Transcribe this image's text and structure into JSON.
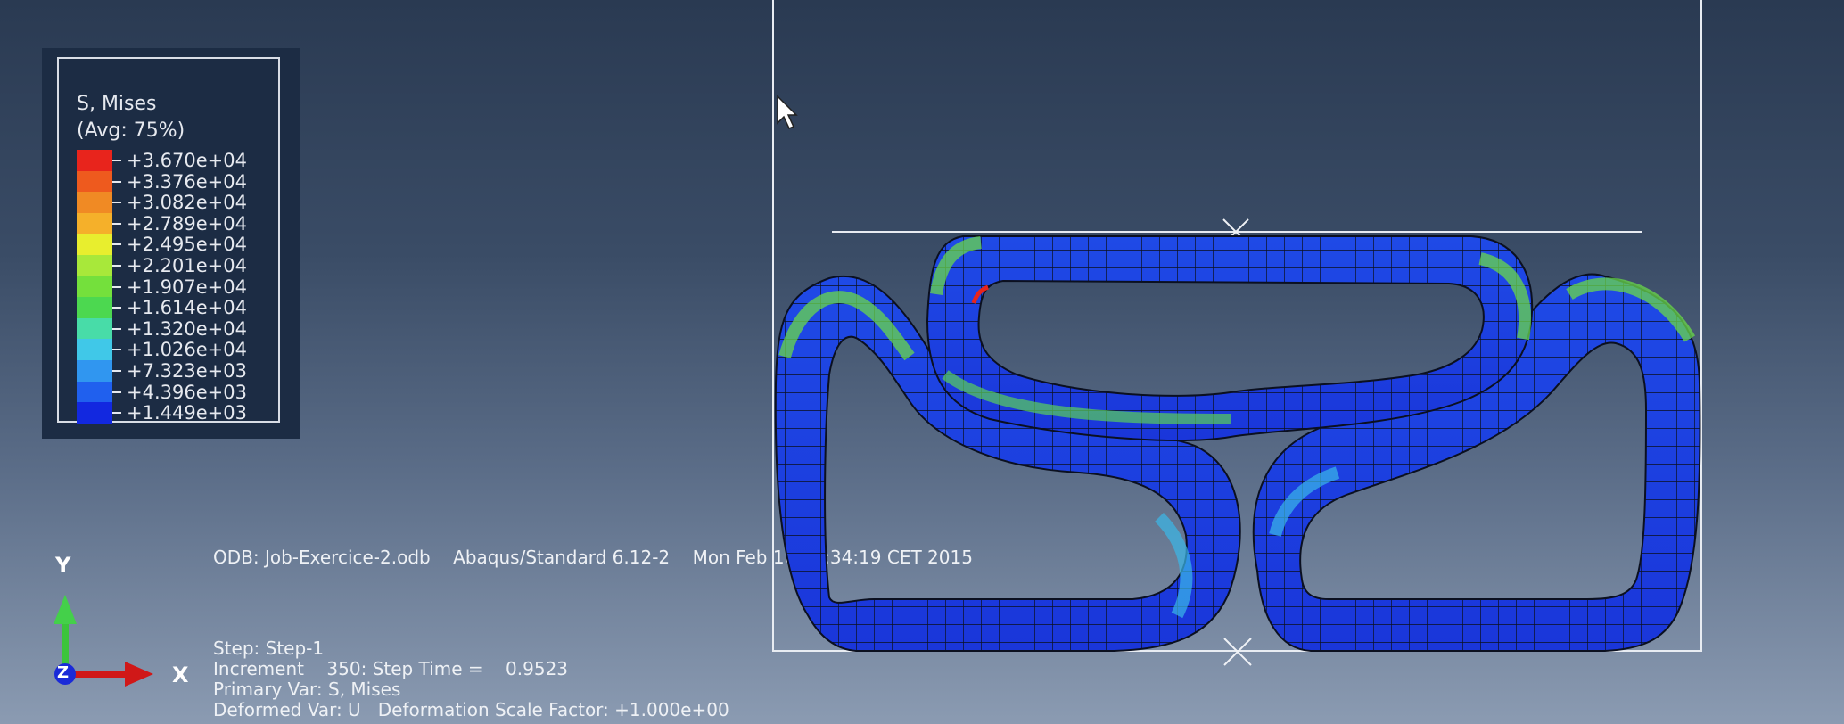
{
  "legend": {
    "title": "S, Mises",
    "subtitle": "(Avg: 75%)",
    "entries": [
      {
        "value": "+3.670e+04",
        "color": "#e8241c"
      },
      {
        "value": "+3.376e+04",
        "color": "#ee5a1e"
      },
      {
        "value": "+3.082e+04",
        "color": "#f08a24"
      },
      {
        "value": "+2.789e+04",
        "color": "#f5b02a"
      },
      {
        "value": "+2.495e+04",
        "color": "#e8ee2e"
      },
      {
        "value": "+2.201e+04",
        "color": "#a8e83a"
      },
      {
        "value": "+1.907e+04",
        "color": "#74e03c"
      },
      {
        "value": "+1.614e+04",
        "color": "#4cd850"
      },
      {
        "value": "+1.320e+04",
        "color": "#48dca8"
      },
      {
        "value": "+1.026e+04",
        "color": "#40c8e8"
      },
      {
        "value": "+7.323e+03",
        "color": "#3096f0"
      },
      {
        "value": "+4.396e+03",
        "color": "#2060ee"
      },
      {
        "value": "+1.449e+03",
        "color": "#1228e0"
      }
    ]
  },
  "info": {
    "odb": "ODB: Job-Exercice-2.odb    Abaqus/Standard 6.12-2    Mon Feb 16 17:34:19 CET 2015",
    "step": "Step: Step-1",
    "increment": "Increment    350: Step Time =    0.9523",
    "primary_var": "Primary Var: S, Mises",
    "deformed_var": "Deformed Var: U   Deformation Scale Factor: +1.000e+00"
  },
  "triad": {
    "y_label": "Y",
    "x_label": "X",
    "z_label": "Z",
    "y_color": "#3cc43c",
    "x_color": "#d01818",
    "z_color": "#1a2ad8"
  },
  "colors": {
    "frame": "#e8ecf2",
    "mesh_edge": "#0b1020",
    "low_stress": "#1a3ae0",
    "mid_stress": "#3ab8e8",
    "high_stress": "#6ad84a"
  }
}
